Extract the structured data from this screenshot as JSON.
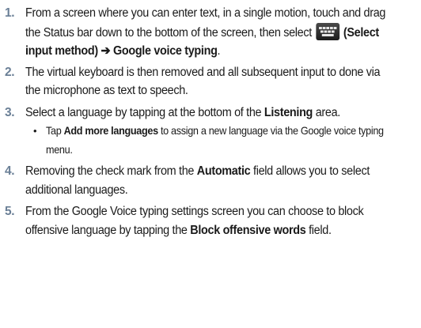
{
  "steps": [
    {
      "number": "1.",
      "text_a": "From a screen where you can enter text, in a single motion, touch and drag the Status bar down to the bottom of the screen, then select",
      "paren_open": "(",
      "bold_1": "Select input method",
      "paren_close": ")",
      "arrow": " ➔ ",
      "bold_2": "Google voice typing",
      "text_end": "."
    },
    {
      "number": "2.",
      "text": "The virtual keyboard is then removed and all subsequent input to done via the microphone as text to speech."
    },
    {
      "number": "3.",
      "text_a": "Select a language by tapping at the bottom of the ",
      "bold_1": "Listening",
      "text_b": " area."
    },
    {
      "number": "4.",
      "text_a": "Removing the check mark from the ",
      "bold_1": "Automatic",
      "text_b": " field allows you to select additional languages."
    },
    {
      "number": "5.",
      "text_a": "From the Google Voice typing settings screen you can choose to block offensive language by tapping the ",
      "bold_1": "Block offensive words",
      "text_b": " field."
    }
  ],
  "substep": {
    "bullet": "•",
    "text_a": "Tap ",
    "bold_1": "Add more languages",
    "text_b": " to assign a new language via the Google voice typing menu."
  },
  "icons": {
    "input_method_icon": "keyboard-icon"
  },
  "colors": {
    "step_number": "#6a7f96",
    "body_text": "#1a1a1a",
    "icon_background": "#2a2a2a"
  }
}
